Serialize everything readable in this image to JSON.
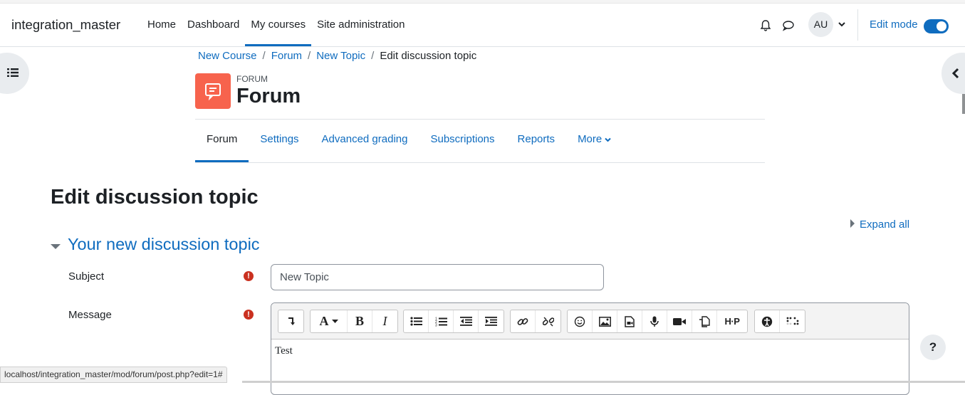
{
  "header": {
    "site_name": "integration_master",
    "nav": [
      "Home",
      "Dashboard",
      "My courses",
      "Site administration"
    ],
    "active_nav": "My courses",
    "avatar_initials": "AU",
    "edit_mode_label": "Edit mode",
    "edit_mode_on": true
  },
  "breadcrumb": {
    "items": [
      "New Course",
      "Forum",
      "New Topic"
    ],
    "current": "Edit discussion topic"
  },
  "module": {
    "type_label": "FORUM",
    "title": "Forum",
    "icon_color": "#f7634d"
  },
  "secondary_nav": {
    "tabs": [
      "Forum",
      "Settings",
      "Advanced grading",
      "Subscriptions",
      "Reports",
      "More"
    ],
    "active": "Forum"
  },
  "page": {
    "title": "Edit discussion topic",
    "expand_all": "Expand all",
    "section_title": "Your new discussion topic"
  },
  "form": {
    "subject_label": "Subject",
    "subject_value": "New Topic",
    "message_label": "Message",
    "message_content": "Test"
  },
  "editor_toolbar": {
    "icons": [
      "collapse-icon",
      "font-size-icon",
      "bold-icon",
      "italic-icon",
      "unordered-list-icon",
      "ordered-list-icon",
      "outdent-icon",
      "indent-icon",
      "link-icon",
      "unlink-icon",
      "emoji-icon",
      "image-icon",
      "media-icon",
      "record-audio-icon",
      "record-video-icon",
      "manage-files-icon",
      "h5p-icon",
      "accessibility-checker-icon",
      "screenreader-helper-icon"
    ]
  },
  "status_bar": {
    "url": "localhost/integration_master/mod/forum/post.php?edit=1#"
  },
  "colors": {
    "primary": "#0f6cbf",
    "required": "#ca3120"
  }
}
